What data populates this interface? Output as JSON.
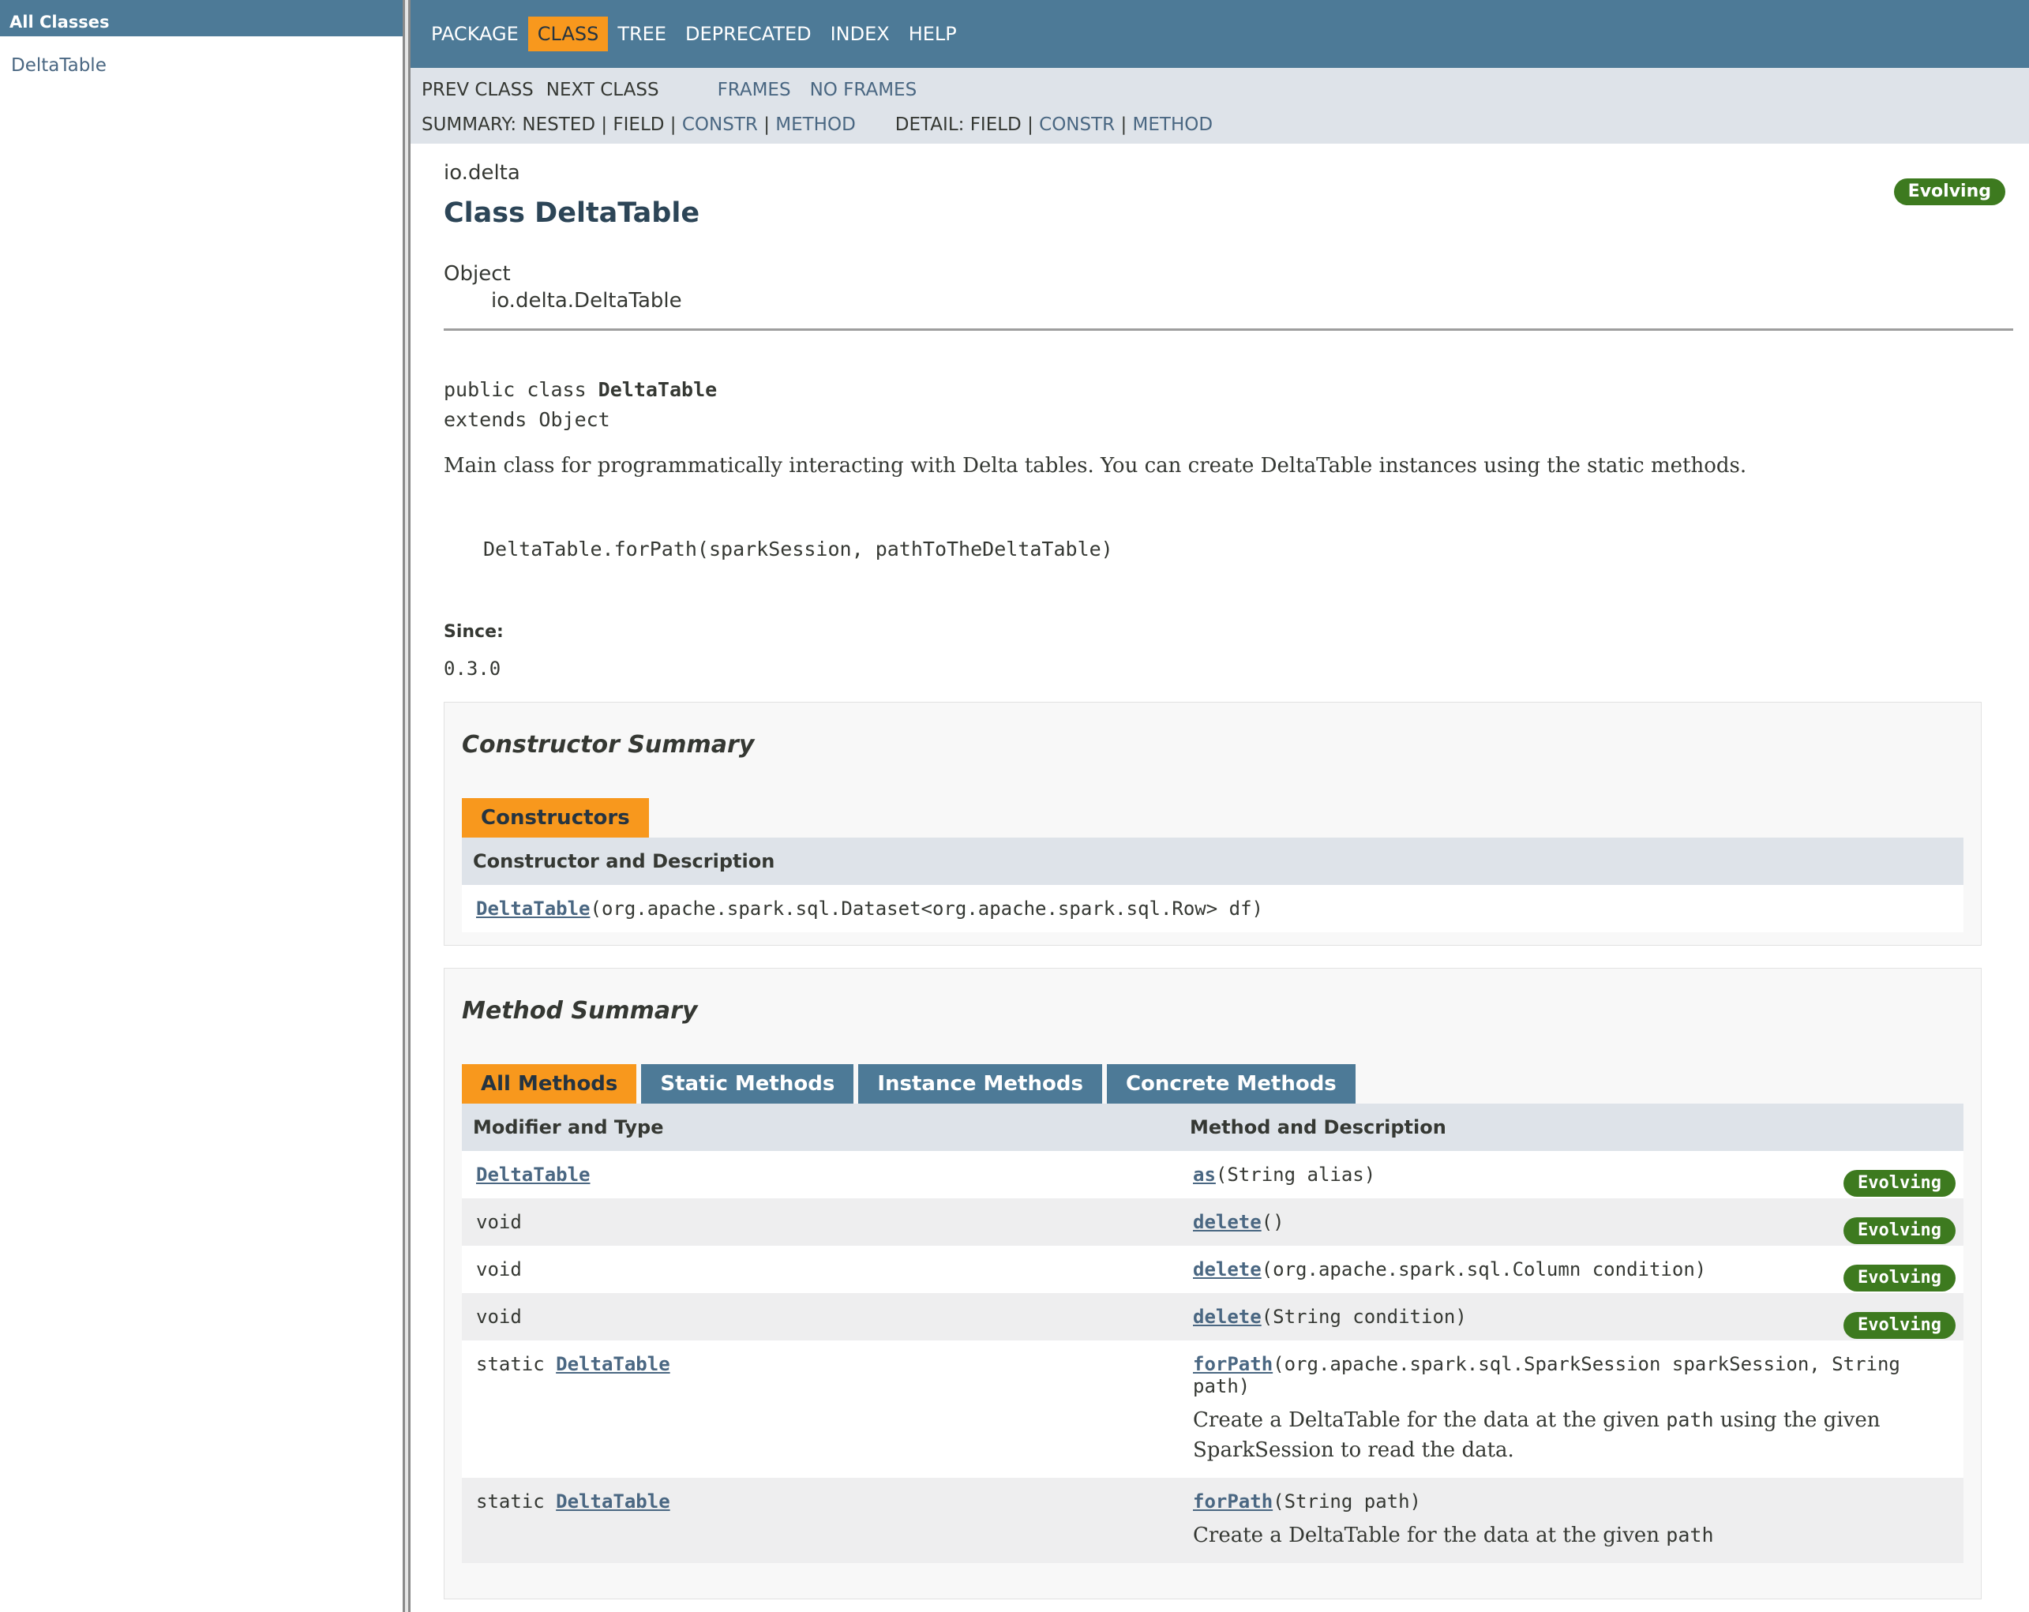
{
  "left_frame": {
    "header": "All Classes",
    "items": [
      "DeltaTable"
    ]
  },
  "top_nav": {
    "items": [
      "PACKAGE",
      "CLASS",
      "TREE",
      "DEPRECATED",
      "INDEX",
      "HELP"
    ],
    "active": "CLASS"
  },
  "sub_nav": {
    "prev_class": "PREV CLASS",
    "next_class": "NEXT CLASS",
    "frames": "FRAMES",
    "no_frames": "NO FRAMES",
    "summary_label": "SUMMARY: NESTED | FIELD |",
    "summary_constr": "CONSTR",
    "summary_sep": "|",
    "summary_method": "METHOD",
    "detail_label": "DETAIL: FIELD |",
    "detail_constr": "CONSTR",
    "detail_sep": "|",
    "detail_method": "METHOD"
  },
  "header": {
    "package": "io.delta",
    "badge": "Evolving",
    "title": "Class DeltaTable",
    "inherit_parent": "Object",
    "inherit_child": "io.delta.DeltaTable"
  },
  "signature": {
    "line1_prefix": "public class ",
    "line1_name": "DeltaTable",
    "line2": "extends Object"
  },
  "description": "Main class for programmatically interacting with Delta tables. You can create DeltaTable instances using the static methods.",
  "code_example": "DeltaTable.forPath(sparkSession, pathToTheDeltaTable)",
  "since": {
    "label": "Since:",
    "value": "0.3.0"
  },
  "constructor_summary": {
    "heading": "Constructor Summary",
    "tab": "Constructors",
    "column": "Constructor and Description",
    "rows": [
      {
        "name": "DeltaTable",
        "params": "(org.apache.spark.sql.Dataset<org.apache.spark.sql.Row> df)"
      }
    ]
  },
  "method_summary": {
    "heading": "Method Summary",
    "tabs": [
      "All Methods",
      "Static Methods",
      "Instance Methods",
      "Concrete Methods"
    ],
    "active_tab": "All Methods",
    "columns": [
      "Modifier and Type",
      "Method and Description"
    ],
    "rows": [
      {
        "modifier": "",
        "type_link": "DeltaTable",
        "method": "as",
        "params": "(String alias)",
        "desc": "",
        "badge": "Evolving"
      },
      {
        "modifier": "void",
        "type_link": "",
        "method": "delete",
        "params": "()",
        "desc": "",
        "badge": "Evolving"
      },
      {
        "modifier": "void",
        "type_link": "",
        "method": "delete",
        "params": "(org.apache.spark.sql.Column condition)",
        "desc": "",
        "badge": "Evolving"
      },
      {
        "modifier": "void",
        "type_link": "",
        "method": "delete",
        "params": "(String condition)",
        "desc": "",
        "badge": "Evolving"
      },
      {
        "modifier": "static ",
        "type_link": "DeltaTable",
        "method": "forPath",
        "params": "(org.apache.spark.sql.SparkSession sparkSession, String path)",
        "desc_pre": "Create a DeltaTable for the data at the given ",
        "desc_code": "path",
        "desc_post": " using the given SparkSession to read the data.",
        "badge": ""
      },
      {
        "modifier": "static ",
        "type_link": "DeltaTable",
        "method": "forPath",
        "params": "(String path)",
        "desc_pre": "Create a DeltaTable for the data at the given ",
        "desc_code": "path",
        "desc_post": "",
        "badge": ""
      }
    ]
  }
}
